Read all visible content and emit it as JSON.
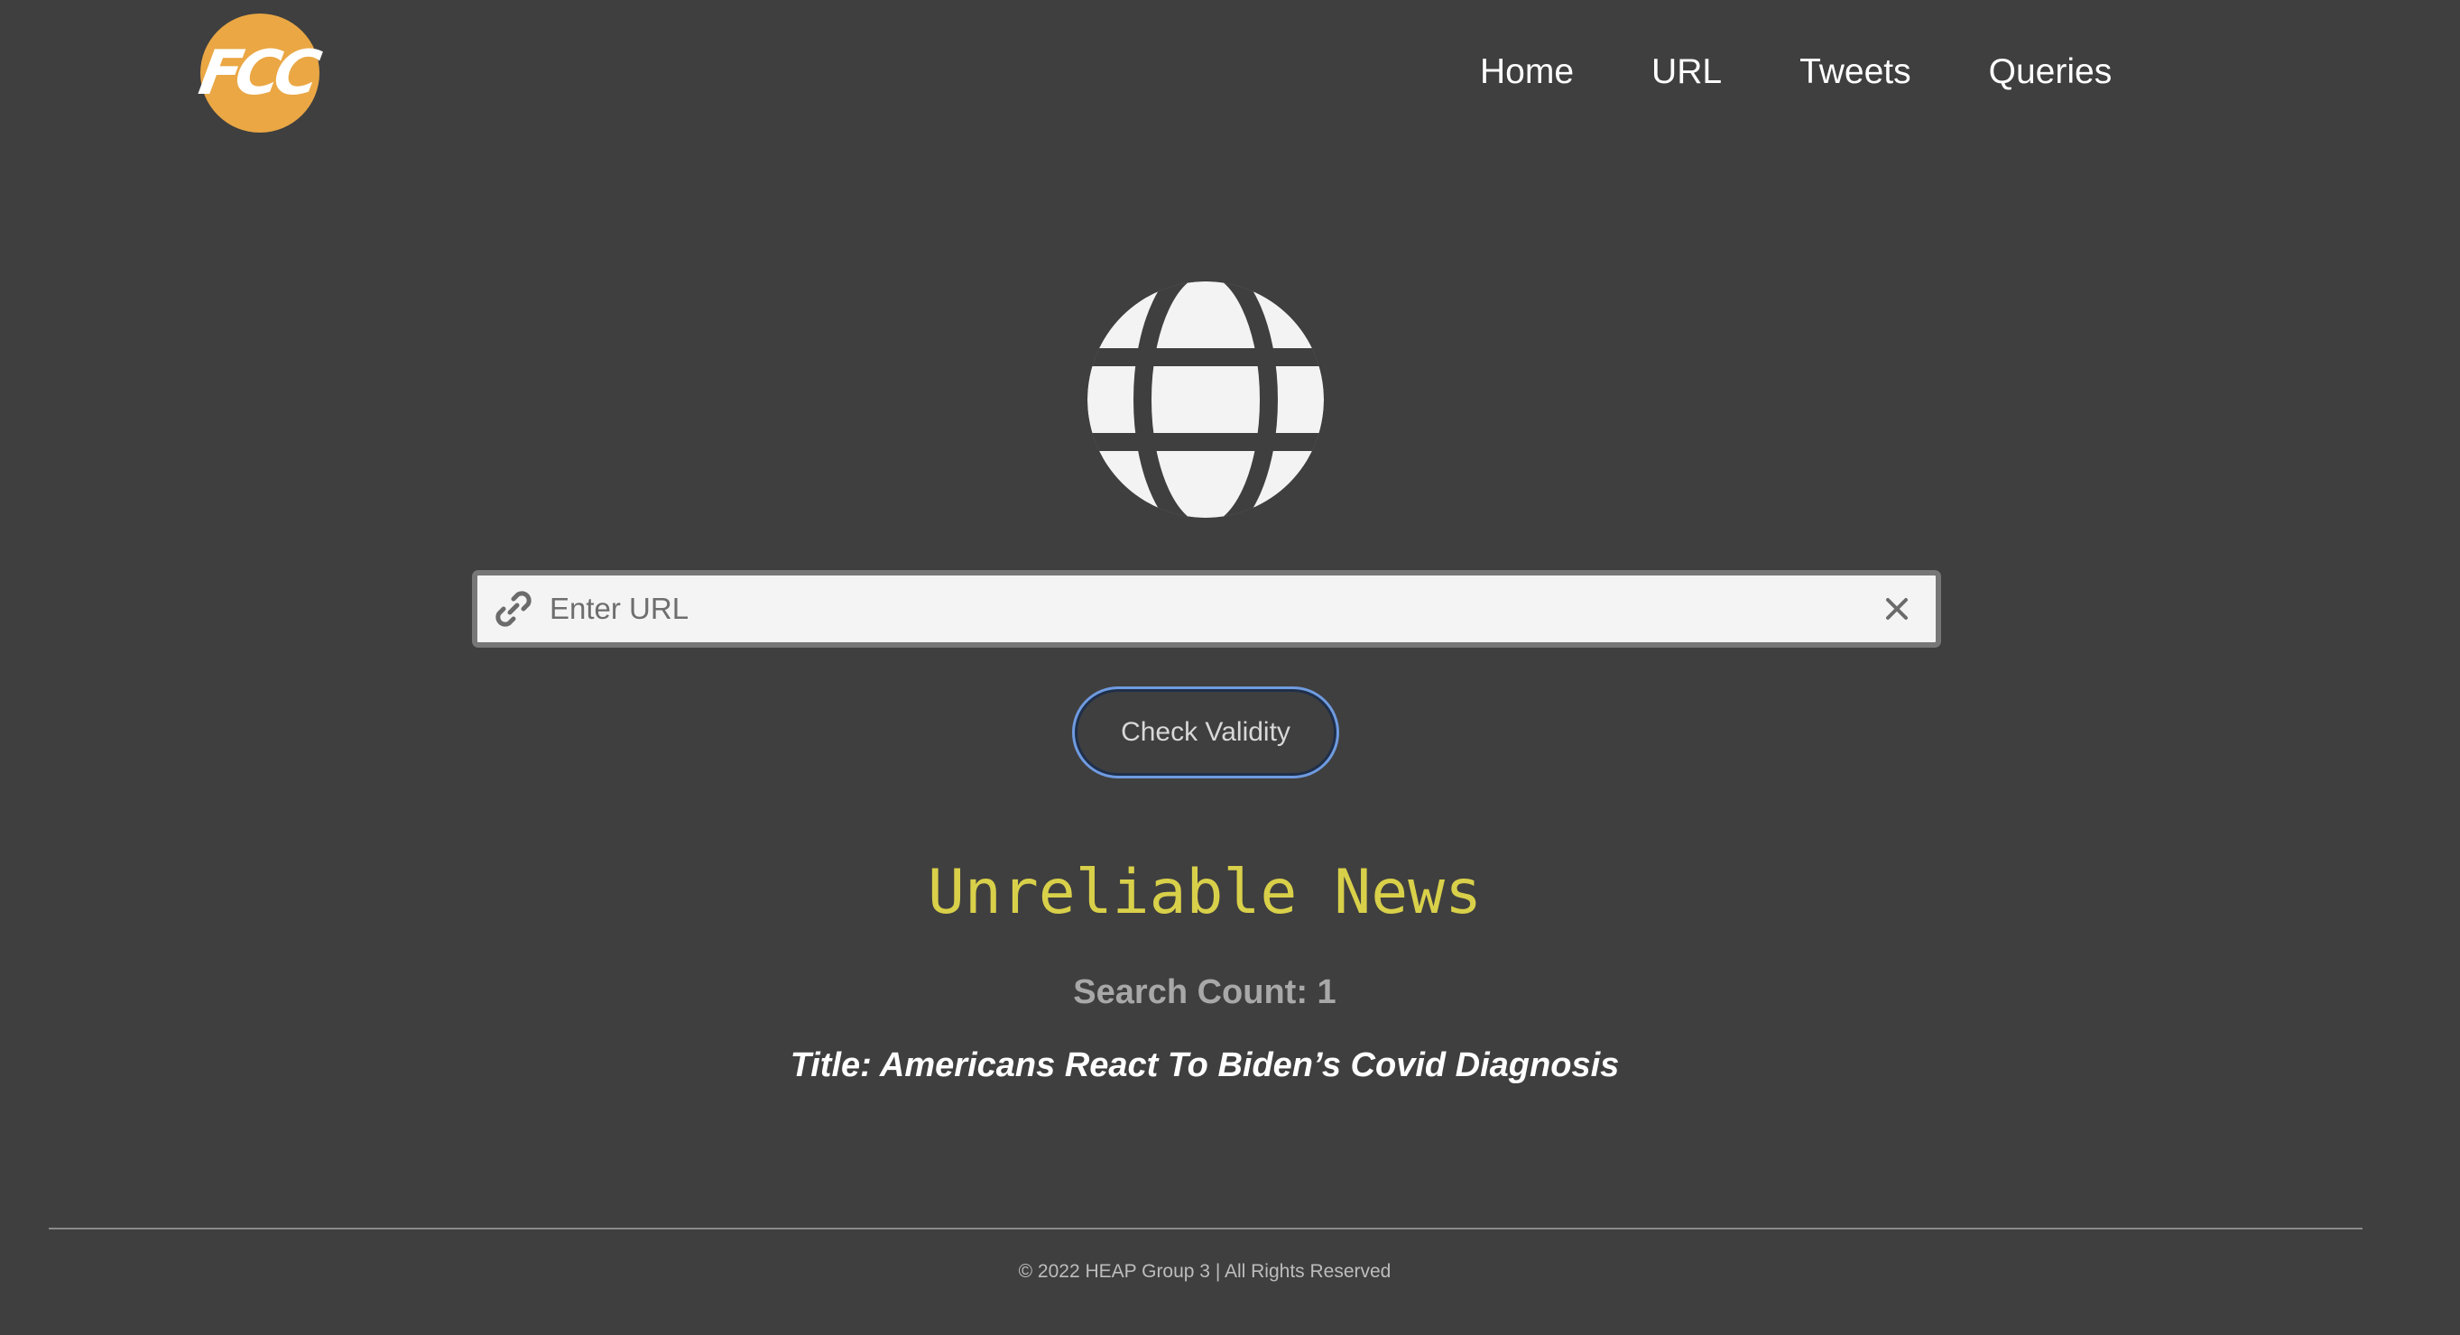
{
  "header": {
    "logo_text": "FCC",
    "nav": [
      {
        "label": "Home"
      },
      {
        "label": "URL"
      },
      {
        "label": "Tweets"
      },
      {
        "label": "Queries"
      }
    ]
  },
  "main": {
    "hero_icon": "globe-icon",
    "url_input": {
      "placeholder": "Enter URL",
      "value": "",
      "leading_icon": "link-icon",
      "trailing_icon": "close-icon"
    },
    "check_button_label": "Check Validity",
    "result": {
      "verdict": "Unreliable News",
      "search_count": "Search Count: 1",
      "title": "Title: Americans React To Biden’s Covid Diagnosis"
    }
  },
  "footer": {
    "copyright": "© 2022 HEAP Group 3 | All Rights Reserved"
  },
  "colors": {
    "background": "#3f3f3f",
    "logo": "#eaa744",
    "verdict": "#d9d04a",
    "button_focus_ring": "#6f9be0"
  }
}
